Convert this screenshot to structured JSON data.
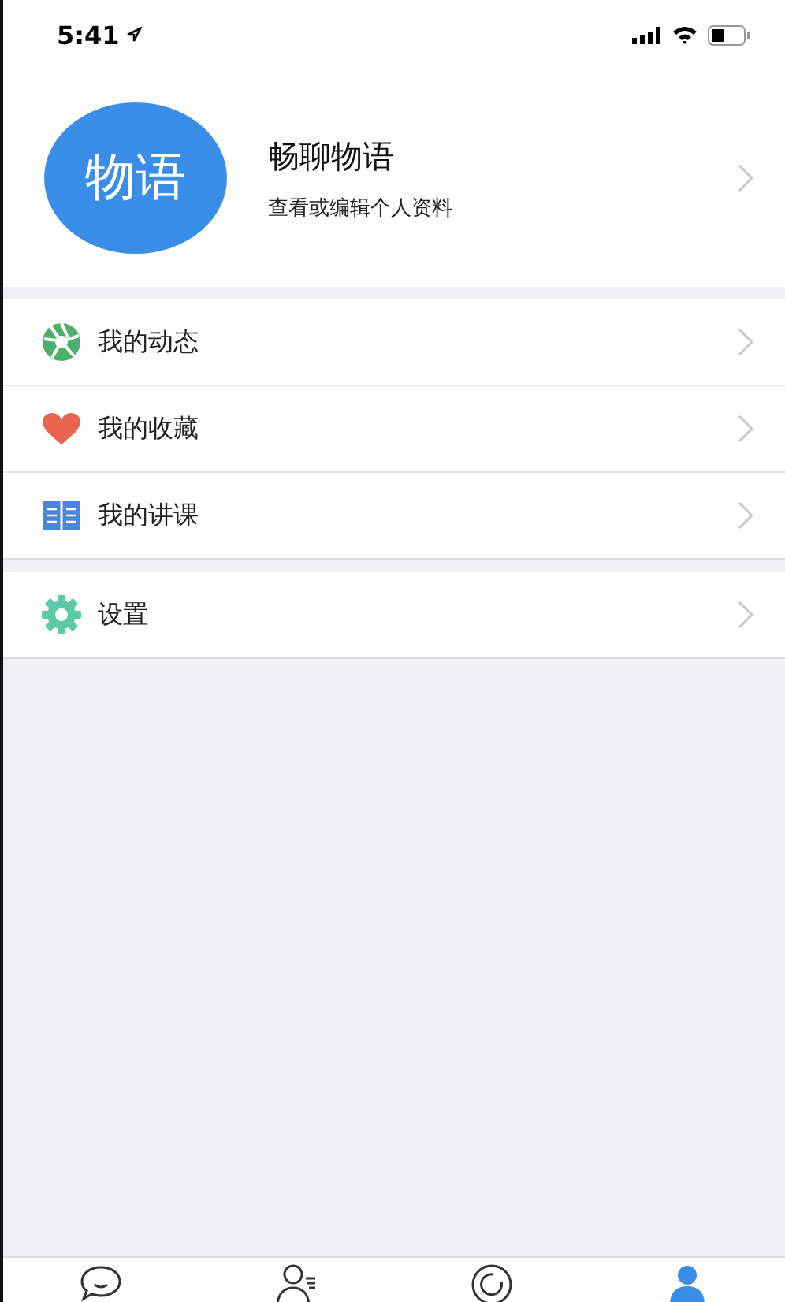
{
  "status_bar": {
    "time": "5:41"
  },
  "profile": {
    "avatar_text": "物语",
    "name": "畅聊物语",
    "subtitle": "查看或编辑个人资料"
  },
  "menu_groups": [
    {
      "items": [
        {
          "kind": "moments",
          "label": "我的动态"
        },
        {
          "kind": "favorites",
          "label": "我的收藏"
        },
        {
          "kind": "lectures",
          "label": "我的讲课"
        }
      ]
    },
    {
      "items": [
        {
          "kind": "settings",
          "label": "设置"
        }
      ]
    }
  ],
  "tabs": [
    {
      "kind": "chat",
      "selected": false
    },
    {
      "kind": "contacts",
      "selected": false
    },
    {
      "kind": "discover",
      "selected": false
    },
    {
      "kind": "me",
      "selected": true
    }
  ]
}
